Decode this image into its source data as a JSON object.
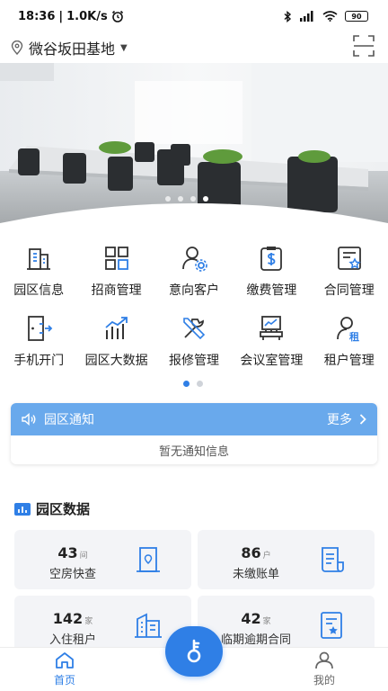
{
  "status_bar": {
    "time": "18:36",
    "network_speed": "1.0K/s",
    "battery": "90",
    "icons": [
      "alarm-icon",
      "bluetooth-icon",
      "signal-icon",
      "wifi-icon",
      "battery-icon"
    ]
  },
  "location": {
    "name": "微谷坂田基地",
    "icon": "location-pin-icon",
    "action_icon": "scan-icon"
  },
  "banner": {
    "slide_count": 4,
    "active_index": 3
  },
  "menu": {
    "rows": [
      [
        {
          "label": "园区信息",
          "icon": "building-icon"
        },
        {
          "label": "招商管理",
          "icon": "grid-squares-icon"
        },
        {
          "label": "意向客户",
          "icon": "user-gear-icon"
        },
        {
          "label": "缴费管理",
          "icon": "payment-icon"
        },
        {
          "label": "合同管理",
          "icon": "contract-icon"
        }
      ],
      [
        {
          "label": "手机开门",
          "icon": "door-icon"
        },
        {
          "label": "园区大数据",
          "icon": "bar-chart-icon"
        },
        {
          "label": "报修管理",
          "icon": "tools-icon"
        },
        {
          "label": "会议室管理",
          "icon": "meeting-room-icon"
        },
        {
          "label": "租户管理",
          "icon": "tenant-icon"
        }
      ]
    ],
    "page_count": 2,
    "active_page": 0
  },
  "notice": {
    "title": "园区通知",
    "more": "更多",
    "empty_text": "暂无通知信息"
  },
  "park_data": {
    "title": "园区数据",
    "cards": [
      {
        "value": "43",
        "unit": "间",
        "label": "空房快查",
        "icon": "door-icon"
      },
      {
        "value": "86",
        "unit": "户",
        "label": "未缴账单",
        "icon": "bill-icon"
      },
      {
        "value": "142",
        "unit": "家",
        "label": "入住租户",
        "icon": "building-icon"
      },
      {
        "value": "42",
        "unit": "家",
        "label": "临期逾期合同",
        "icon": "contract-icon"
      }
    ]
  },
  "bottom_nav": {
    "home": "首页",
    "mine": "我的"
  },
  "colors": {
    "accent": "#2f7fe6",
    "notice_header": "#69a9ec",
    "card_bg": "#f3f4f7"
  }
}
